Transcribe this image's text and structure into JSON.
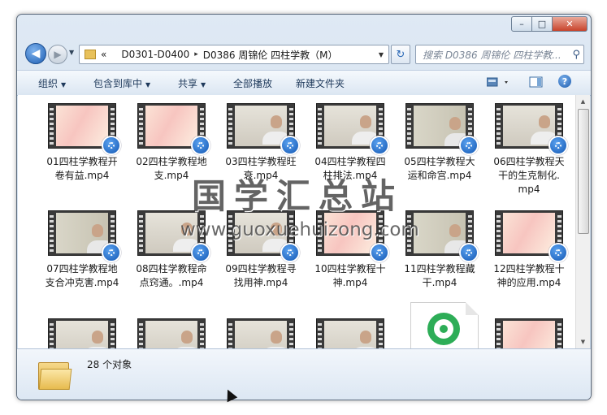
{
  "window": {
    "caption_buttons": {
      "min": "–",
      "max": "□",
      "close": "✕"
    }
  },
  "nav": {
    "back_glyph": "◀",
    "forward_glyph": "▶",
    "history_glyph": "▼",
    "address": {
      "overflow": "«",
      "crumbs": [
        "D0301-D0400",
        "D0386 周锦伦 四柱学教（M）"
      ],
      "sep_glyph": "▸",
      "dropdown_glyph": "▼"
    },
    "refresh_glyph": "↻",
    "search_placeholder": "搜索 D0386 周锦伦 四柱学教...",
    "search_icon_glyph": "⚲"
  },
  "toolbar": {
    "organize": "组织",
    "include_in_library": "包含到库中",
    "share": "共享",
    "play_all": "全部播放",
    "new_folder": "新建文件夹",
    "dropdown_glyph": "▼",
    "help_glyph": "?"
  },
  "files": [
    {
      "name": "01四柱学教程开卷有益.mp4",
      "lines": [
        "01四柱学教程开",
        "卷有益.mp4"
      ],
      "thumb": "pink"
    },
    {
      "name": "02四柱学教程地支.mp4",
      "lines": [
        "02四柱学教程地",
        "支.mp4"
      ],
      "thumb": "pink"
    },
    {
      "name": "03四柱学教程旺衰.mp4",
      "lines": [
        "03四柱学教程旺",
        "衰.mp4"
      ],
      "thumb": "man"
    },
    {
      "name": "04四柱学教程四柱排法.mp4",
      "lines": [
        "04四柱学教程四",
        "柱排法.mp4"
      ],
      "thumb": "man"
    },
    {
      "name": "05四柱学教程大运和命宫.mp4",
      "lines": [
        "05四柱学教程大",
        "运和命宫.mp4"
      ],
      "thumb": "board"
    },
    {
      "name": "06四柱学教程天干的生克制化.mp4",
      "lines": [
        "06四柱学教程天",
        "干的生克制化.",
        "mp4"
      ],
      "thumb": "man"
    },
    {
      "name": "07四柱学教程地支合冲克害.mp4",
      "lines": [
        "07四柱学教程地",
        "支合冲克害.mp4"
      ],
      "thumb": "board"
    },
    {
      "name": "08四柱学教程命点窍通。.mp4",
      "lines": [
        "08四柱学教程命",
        "点窍通。.mp4"
      ],
      "thumb": "man"
    },
    {
      "name": "09四柱学教程寻找用神.mp4",
      "lines": [
        "09四柱学教程寻",
        "找用神.mp4"
      ],
      "thumb": "man"
    },
    {
      "name": "10四柱学教程十神.mp4",
      "lines": [
        "10四柱学教程十",
        "神.mp4"
      ],
      "thumb": "pink"
    },
    {
      "name": "11四柱学教程藏干.mp4",
      "lines": [
        "11四柱学教程藏",
        "干.mp4"
      ],
      "thumb": "board"
    },
    {
      "name": "12四柱学教程十神的应用.mp4",
      "lines": [
        "12四柱学教程十",
        "神的应用.mp4"
      ],
      "thumb": "pink"
    }
  ],
  "row3": [
    "man",
    "man",
    "man",
    "man",
    "doc",
    "pink"
  ],
  "watermark": {
    "title": "国学汇总站",
    "url": "www.guoxuehuizong.com"
  },
  "status": {
    "item_count": "28 个对象"
  }
}
